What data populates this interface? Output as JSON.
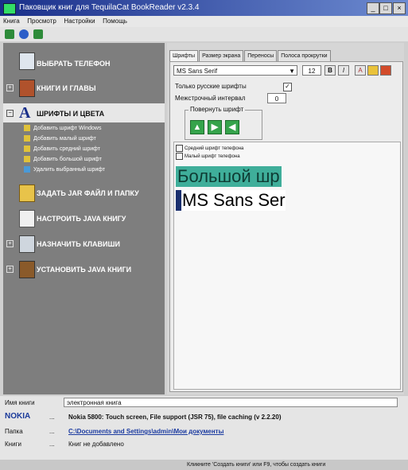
{
  "window": {
    "title": "Паковщик книг для TequilaCat BookReader v2.3.4",
    "controls": [
      "_",
      "□",
      "×"
    ]
  },
  "menu": [
    "Книга",
    "Просмотр",
    "Настройки",
    "Помощь"
  ],
  "toolbar": {
    "icons": [
      "new-book-icon",
      "globe-icon",
      "settings-icon"
    ]
  },
  "sidebar": {
    "items": [
      {
        "label": "ВЫБРАТЬ ТЕЛЕФОН",
        "icon": "phone-icon"
      },
      {
        "label": "КНИГИ И ГЛАВЫ",
        "icon": "books-icon"
      },
      {
        "label": "ШРИФТЫ И ЦВЕТА",
        "icon": "font-icon"
      },
      {
        "label": "ЗАДАТЬ JAR ФАЙЛ И ПАПКУ",
        "icon": "folder-icon"
      },
      {
        "label": "НАСТРОИТЬ JAVA КНИГУ",
        "icon": "java-icon"
      },
      {
        "label": "НАЗНАЧИТЬ КЛАВИШИ",
        "icon": "keyboard-icon"
      },
      {
        "label": "УСТАНОВИТЬ JAVA КНИГИ",
        "icon": "install-icon"
      }
    ],
    "subitems": [
      "Добавить шрифт Windows",
      "Добавить малый шрифт",
      "Добавить средний шрифт",
      "Добавить большой шрифт",
      "Удалить выбранный шрифт"
    ]
  },
  "tabs": [
    "Шрифты",
    "Размер экрана",
    "Переносы",
    "Полоса прокрутки"
  ],
  "fonts_panel": {
    "font_name": "MS Sans Serif",
    "font_size": "12",
    "bold": "B",
    "italic": "I",
    "only_russian_label": "Только русские шрифты",
    "only_russian_checked": "✓",
    "line_spacing_label": "Межстрочный интервал",
    "line_spacing_value": "0",
    "rotate_label": "Повернуть шрифт",
    "rotate_buttons": [
      "▲",
      "▶",
      "◀"
    ],
    "preview_items": [
      "Средний шрифт телефона",
      "Малый шрифт телефона"
    ],
    "preview_big": "Большой шр",
    "preview_ms": "MS Sans Ser"
  },
  "bottom": {
    "book_name_label": "Имя книги",
    "book_name_value": "электронная книга",
    "phone_brand": "NOKIA",
    "phone_value": "Nokia 5800: Touch screen, File support (JSR 75), file caching (v 2.2.20)",
    "folder_label": "Папка",
    "folder_value": "C:\\Documents and Settings\\admin\\Мои документы",
    "books_label": "Книги",
    "books_value": "Книг не добавлено",
    "ellipsis": "..."
  },
  "status_bar": "Кликните 'Создать книги' или F9, чтобы создать книги",
  "colors": {
    "title_gradient_start": "#1a2f8a",
    "sidebar_bg": "#7e7e7e",
    "preview_highlight": "#3fae9a",
    "accent_green": "#35a34b"
  }
}
